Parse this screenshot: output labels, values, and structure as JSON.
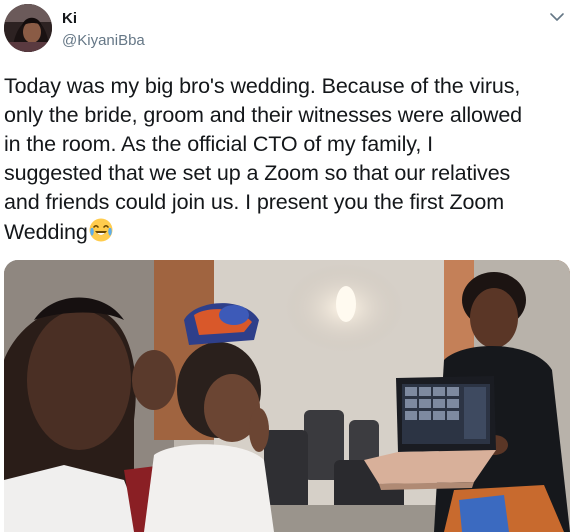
{
  "author": {
    "name": "Ki",
    "handle": "@KiyaniBba"
  },
  "tweet": {
    "lines": [
      "Today was my big bro's wedding. Because of the virus,",
      "only the bride, groom and their witnesses were allowed",
      "in the room. As the official CTO of my family, I",
      "suggested that we set up a Zoom so that our relatives",
      "and friends could join us. I present you the first Zoom",
      "Wedding"
    ],
    "emoji": "face-with-tears-of-joy"
  },
  "icons": {
    "caret": "chevron-down-icon",
    "avatar": "avatar"
  },
  "media": {
    "type": "photo"
  },
  "colors": {
    "text": "#14171a",
    "secondary": "#657786",
    "background": "#ffffff"
  }
}
